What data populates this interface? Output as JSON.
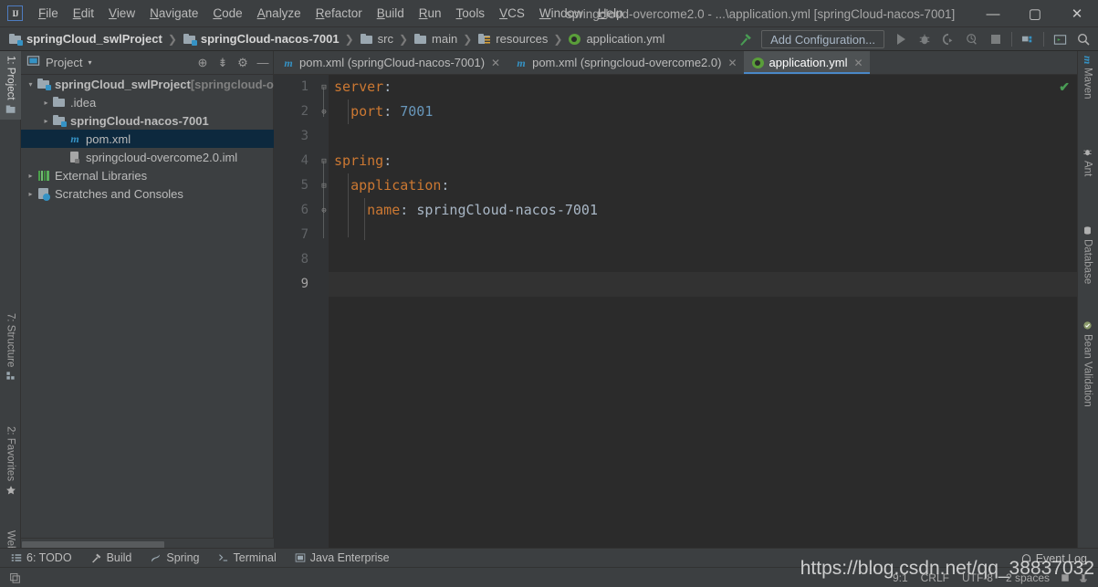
{
  "window": {
    "title": "springcloud-overcome2.0 - ...\\application.yml [springCloud-nacos-7001]",
    "minimize": "—",
    "maximize": "▢",
    "close": "✕",
    "logo": "IJ"
  },
  "menu": [
    {
      "label": "File"
    },
    {
      "label": "Edit"
    },
    {
      "label": "View"
    },
    {
      "label": "Navigate"
    },
    {
      "label": "Code"
    },
    {
      "label": "Analyze"
    },
    {
      "label": "Refactor"
    },
    {
      "label": "Build"
    },
    {
      "label": "Run"
    },
    {
      "label": "Tools"
    },
    {
      "label": "VCS"
    },
    {
      "label": "Window"
    },
    {
      "label": "Help"
    }
  ],
  "breadcrumb": [
    {
      "label": "springCloud_swlProject",
      "icon": "module-icon",
      "bold": true
    },
    {
      "label": "springCloud-nacos-7001",
      "icon": "module-icon",
      "bold": true
    },
    {
      "label": "src",
      "icon": "folder-icon",
      "bold": false
    },
    {
      "label": "main",
      "icon": "folder-icon",
      "bold": false
    },
    {
      "label": "resources",
      "icon": "resources-folder-icon",
      "bold": false
    },
    {
      "label": "application.yml",
      "icon": "yaml-file-icon",
      "bold": false
    }
  ],
  "breadcrumb_separator": "❯",
  "toolbar": {
    "build_label": "build-hammer-icon",
    "add_configuration": "Add Configuration...",
    "run_icon": "run-icon",
    "debug_icon": "debug-icon",
    "run_coverage_icon": "run-with-coverage-icon",
    "profiler_icon": "profiler-icon",
    "stop_icon": "stop-icon",
    "project_structure_icon": "project-structure-icon",
    "terminal_icon": "terminal-icon",
    "search_icon": "search-everywhere-icon"
  },
  "left_tabs": [
    {
      "label": "1: Project",
      "icon": "project-icon",
      "active": true
    },
    {
      "label": "7: Structure",
      "icon": "structure-icon",
      "active": false
    },
    {
      "label": "2: Favorites",
      "icon": "favorites-star-icon",
      "active": false
    },
    {
      "label": "Web",
      "icon": "web-globe-icon",
      "active": false
    }
  ],
  "right_tabs": [
    {
      "label": "Maven",
      "icon": "maven-icon"
    },
    {
      "label": "Ant",
      "icon": "ant-icon"
    },
    {
      "label": "Database",
      "icon": "database-icon"
    },
    {
      "label": "Bean Validation",
      "icon": "bean-validation-icon"
    }
  ],
  "project_panel": {
    "title": "Project",
    "caret": "▾",
    "actions": [
      {
        "name": "locate-icon",
        "glyph": "⊕"
      },
      {
        "name": "collapse-all-icon",
        "glyph": "⇟"
      },
      {
        "name": "settings-gear-icon",
        "glyph": "⚙"
      },
      {
        "name": "hide-icon",
        "glyph": "—"
      }
    ],
    "tree": [
      {
        "label": "springCloud_swlProject",
        "suffix": " [springcloud-ov",
        "depth": 0,
        "arrow": "▾",
        "icon": "module-icon",
        "bold": true,
        "selected": false
      },
      {
        "label": ".idea",
        "suffix": "",
        "depth": 1,
        "arrow": "▸",
        "icon": "folder-icon",
        "bold": false,
        "selected": false
      },
      {
        "label": "springCloud-nacos-7001",
        "suffix": "",
        "depth": 1,
        "arrow": "▸",
        "icon": "module-icon",
        "bold": true,
        "selected": false
      },
      {
        "label": "pom.xml",
        "suffix": "",
        "depth": 2,
        "arrow": "",
        "icon": "maven-pom-icon",
        "bold": false,
        "selected": true
      },
      {
        "label": "springcloud-overcome2.0.iml",
        "suffix": "",
        "depth": 2,
        "arrow": "",
        "icon": "iml-file-icon",
        "bold": false,
        "selected": false
      },
      {
        "label": "External Libraries",
        "suffix": "",
        "depth": 0,
        "arrow": "▸",
        "icon": "libraries-icon",
        "bold": false,
        "selected": false
      },
      {
        "label": "Scratches and Consoles",
        "suffix": "",
        "depth": 0,
        "arrow": "▸",
        "icon": "scratches-icon",
        "bold": false,
        "selected": false
      }
    ]
  },
  "editor": {
    "tabs": [
      {
        "label": "pom.xml (springCloud-nacos-7001)",
        "icon": "maven-pom-icon",
        "active": false,
        "close": "✕"
      },
      {
        "label": "pom.xml (springcloud-overcome2.0)",
        "icon": "maven-pom-icon",
        "active": false,
        "close": "✕"
      },
      {
        "label": "application.yml",
        "icon": "yaml-file-icon",
        "active": true,
        "close": "✕"
      }
    ],
    "inspection_status": "✔",
    "gutter_numbers": [
      "1",
      "2",
      "3",
      "4",
      "5",
      "6",
      "7",
      "8",
      "9"
    ],
    "current_line_index": 8,
    "fold_markers": [
      "⊟",
      "⊖",
      "",
      "⊟",
      "⊟",
      "⊖",
      "",
      "",
      ""
    ],
    "lines": [
      {
        "n": 1,
        "tokens": [
          {
            "t": "server",
            "c": "k"
          },
          {
            "t": ":",
            "c": "p"
          }
        ]
      },
      {
        "n": 2,
        "tokens": [
          {
            "t": "  ",
            "c": "p"
          },
          {
            "t": "port",
            "c": "k"
          },
          {
            "t": ": ",
            "c": "p"
          },
          {
            "t": "7001",
            "c": "n"
          }
        ]
      },
      {
        "n": 3,
        "tokens": []
      },
      {
        "n": 4,
        "tokens": [
          {
            "t": "spring",
            "c": "k"
          },
          {
            "t": ":",
            "c": "p"
          }
        ]
      },
      {
        "n": 5,
        "tokens": [
          {
            "t": "  ",
            "c": "p"
          },
          {
            "t": "application",
            "c": "k"
          },
          {
            "t": ":",
            "c": "p"
          }
        ]
      },
      {
        "n": 6,
        "tokens": [
          {
            "t": "    ",
            "c": "p"
          },
          {
            "t": "name",
            "c": "k"
          },
          {
            "t": ": ",
            "c": "p"
          },
          {
            "t": "springCloud-nacos-7001",
            "c": "v"
          }
        ]
      },
      {
        "n": 7,
        "tokens": []
      },
      {
        "n": 8,
        "tokens": []
      },
      {
        "n": 9,
        "tokens": []
      }
    ]
  },
  "bottom_bar": [
    {
      "label": "6: TODO",
      "icon": "todo-list-icon"
    },
    {
      "label": "Build",
      "icon": "build-hammer-icon"
    },
    {
      "label": "Spring",
      "icon": "spring-leaf-icon"
    },
    {
      "label": "Terminal",
      "icon": "terminal-icon"
    },
    {
      "label": "Java Enterprise",
      "icon": "java-enterprise-icon"
    }
  ],
  "status_bar": {
    "caret_position": "9:1",
    "line_separator": "CRLF",
    "encoding": "UTF-8",
    "indent": "2 spaces",
    "lock_icon": "read-only-toggle-icon",
    "inspection_icon": "inspection-profile-icon",
    "event_log": "Event Log",
    "event_log_icon": "event-log-icon"
  },
  "watermark": "https://blog.csdn.net/qq_38837032",
  "colors": {
    "background": "#3c3f41",
    "editor_background": "#2b2b2b",
    "gutter": "#313335",
    "selection": "#0d293e",
    "accent": "#4a88c7",
    "keyword": "#cc7832",
    "number": "#6897bb",
    "text": "#a9b7c6",
    "ok_green": "#499c54"
  }
}
